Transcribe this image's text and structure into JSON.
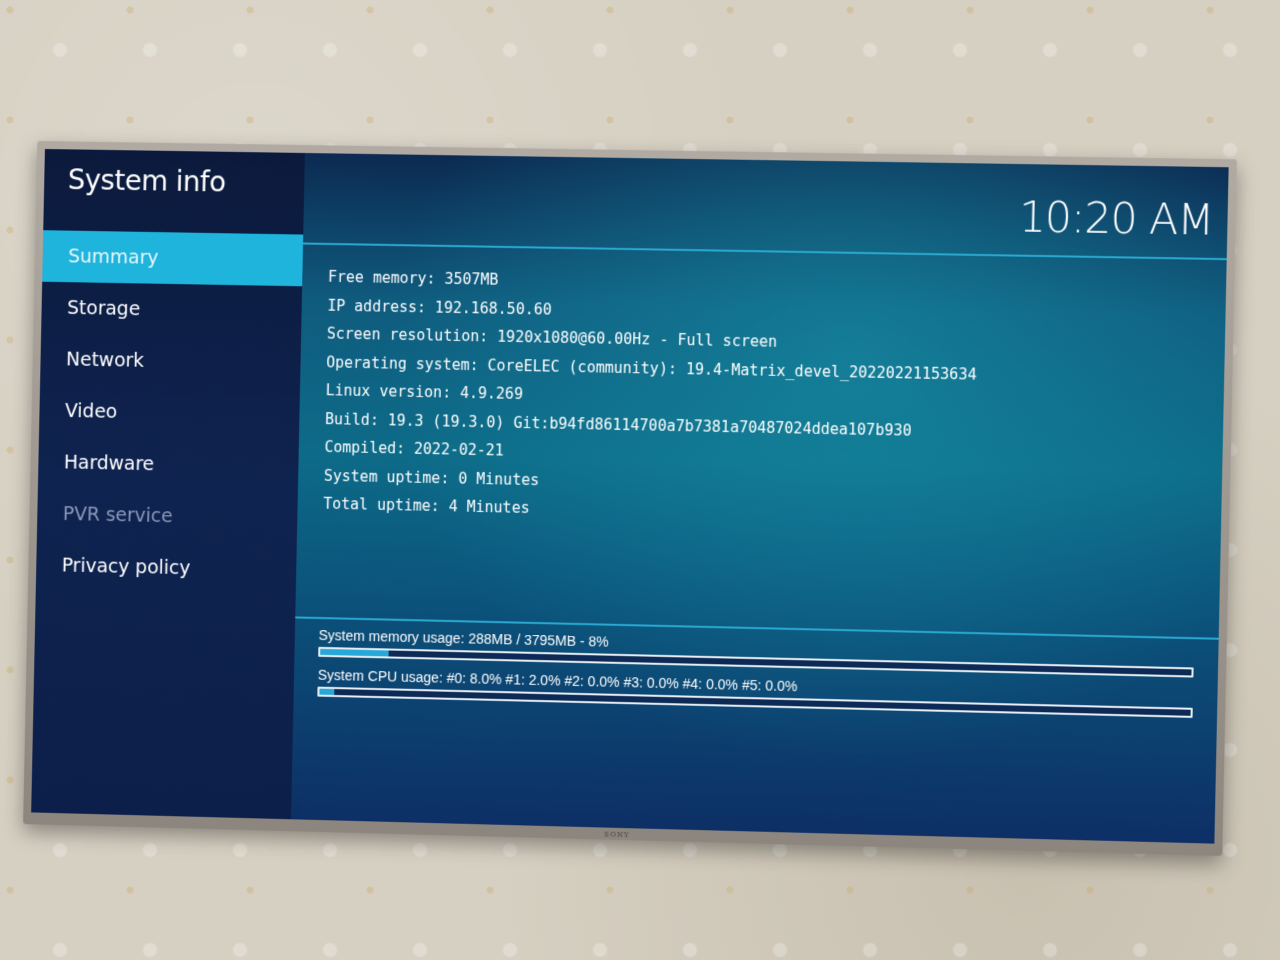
{
  "device": {
    "brand": "SONY"
  },
  "sidebar": {
    "title": "System info",
    "items": [
      {
        "label": "Summary",
        "state": "active"
      },
      {
        "label": "Storage",
        "state": "normal"
      },
      {
        "label": "Network",
        "state": "normal"
      },
      {
        "label": "Video",
        "state": "normal"
      },
      {
        "label": "Hardware",
        "state": "normal"
      },
      {
        "label": "PVR service",
        "state": "disabled"
      },
      {
        "label": "Privacy policy",
        "state": "normal"
      }
    ]
  },
  "header": {
    "clock": "10:20 AM"
  },
  "summary": {
    "lines": [
      "Free memory: 3507MB",
      "IP address: 192.168.50.60",
      "Screen resolution: 1920x1080@60.00Hz - Full screen",
      "Operating system: CoreELEC (community): 19.4-Matrix_devel_20220221153634",
      "Linux version: 4.9.269",
      "Build: 19.3 (19.3.0) Git:b94fd86114700a7b7381a70487024ddea107b930",
      "Compiled: 2022-02-21",
      "System uptime: 0 Minutes",
      "Total uptime: 4 Minutes"
    ]
  },
  "stats": {
    "memory": {
      "label": "System memory usage: 288MB / 3795MB - 8%",
      "percent": 8
    },
    "cpu": {
      "label": "System CPU usage: #0: 8.0% #1: 2.0% #2: 0.0% #3: 0.0% #4: 0.0% #5: 0.0%",
      "percent": 1.7
    }
  },
  "colors": {
    "accent": "#1fb4dc",
    "sidebar_bg": "#0f2350",
    "disabled_text": "#8a98b8"
  }
}
